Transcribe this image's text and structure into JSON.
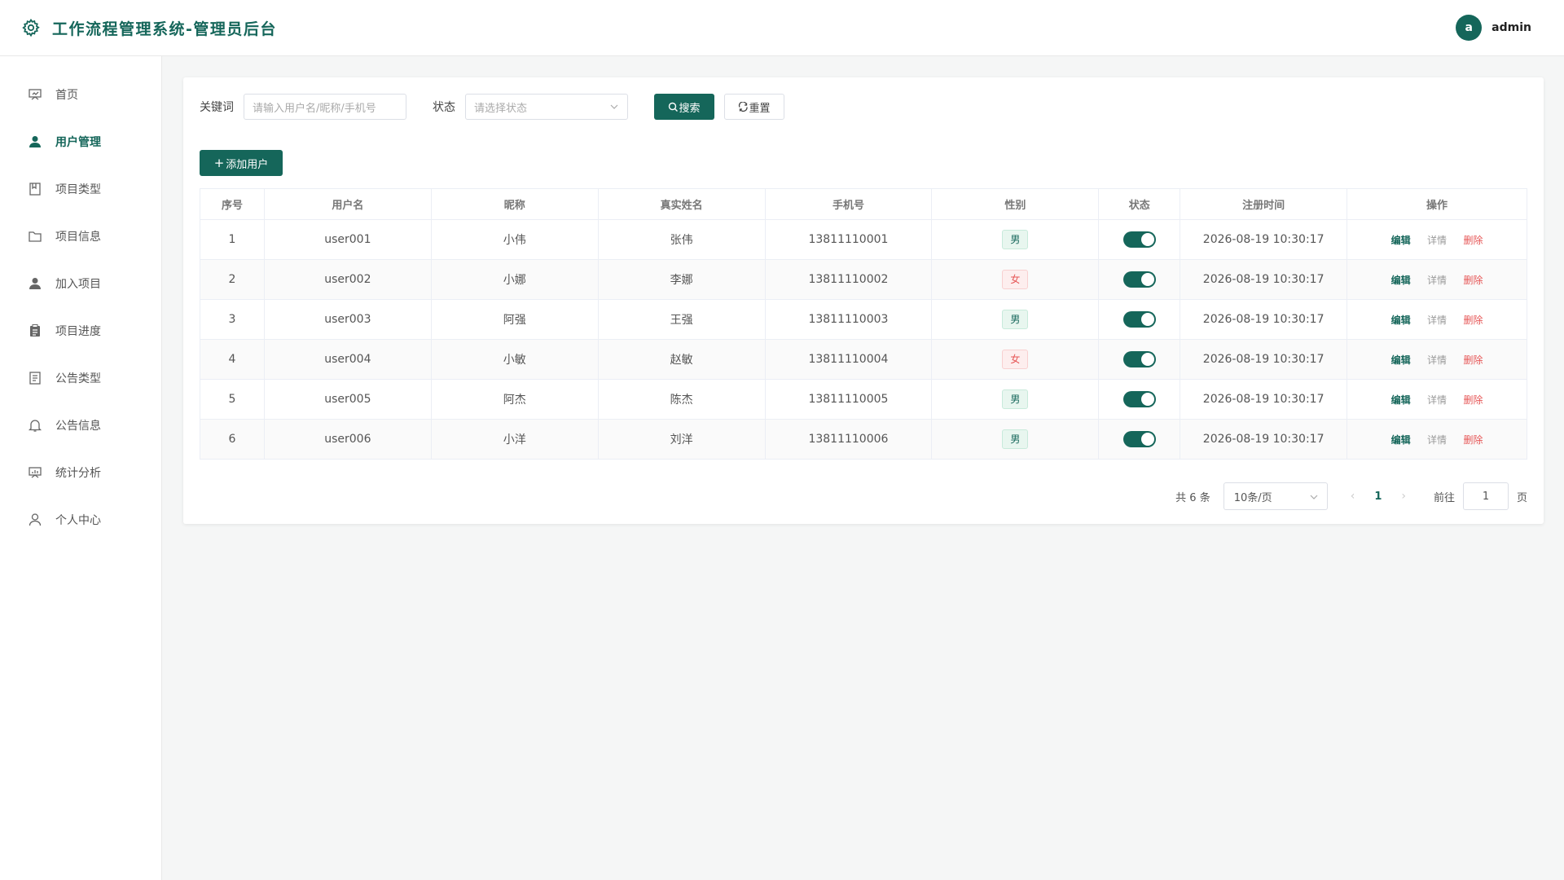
{
  "header": {
    "title": "工作流程管理系统-管理员后台",
    "avatar_letter": "a",
    "username": "admin"
  },
  "sidebar": {
    "items": [
      {
        "label": "首页",
        "icon": "home-board-icon"
      },
      {
        "label": "用户管理",
        "icon": "user-filled-icon",
        "active": true
      },
      {
        "label": "项目类型",
        "icon": "bookmark-icon"
      },
      {
        "label": "项目信息",
        "icon": "folder-icon"
      },
      {
        "label": "加入项目",
        "icon": "user-add-icon"
      },
      {
        "label": "项目进度",
        "icon": "clipboard-icon"
      },
      {
        "label": "公告类型",
        "icon": "document-icon"
      },
      {
        "label": "公告信息",
        "icon": "bell-icon"
      },
      {
        "label": "统计分析",
        "icon": "chart-board-icon"
      },
      {
        "label": "个人中心",
        "icon": "user-outline-icon"
      }
    ]
  },
  "filters": {
    "keyword_label": "关键词",
    "keyword_placeholder": "请输入用户名/昵称/手机号",
    "status_label": "状态",
    "status_placeholder": "请选择状态",
    "search_label": "搜索",
    "reset_label": "重置"
  },
  "add_button_label": "添加用户",
  "table": {
    "headers": [
      "序号",
      "用户名",
      "昵称",
      "真实姓名",
      "手机号",
      "性别",
      "状态",
      "注册时间",
      "操作"
    ],
    "rows": [
      {
        "index": "1",
        "username": "user001",
        "nickname": "小伟",
        "realname": "张伟",
        "phone": "13811110001",
        "gender": "男",
        "enabled": true,
        "registered": "2026-08-19 10:30:17"
      },
      {
        "index": "2",
        "username": "user002",
        "nickname": "小娜",
        "realname": "李娜",
        "phone": "13811110002",
        "gender": "女",
        "enabled": true,
        "registered": "2026-08-19 10:30:17"
      },
      {
        "index": "3",
        "username": "user003",
        "nickname": "阿强",
        "realname": "王强",
        "phone": "13811110003",
        "gender": "男",
        "enabled": true,
        "registered": "2026-08-19 10:30:17"
      },
      {
        "index": "4",
        "username": "user004",
        "nickname": "小敏",
        "realname": "赵敏",
        "phone": "13811110004",
        "gender": "女",
        "enabled": true,
        "registered": "2026-08-19 10:30:17"
      },
      {
        "index": "5",
        "username": "user005",
        "nickname": "阿杰",
        "realname": "陈杰",
        "phone": "13811110005",
        "gender": "男",
        "enabled": true,
        "registered": "2026-08-19 10:30:17"
      },
      {
        "index": "6",
        "username": "user006",
        "nickname": "小洋",
        "realname": "刘洋",
        "phone": "13811110006",
        "gender": "男",
        "enabled": true,
        "registered": "2026-08-19 10:30:17"
      }
    ],
    "ops": {
      "edit": "编辑",
      "detail": "详情",
      "delete": "删除"
    }
  },
  "pagination": {
    "total_text": "共 6 条",
    "page_size": "10条/页",
    "current_page": "1",
    "goto_label": "前往",
    "goto_value": "1",
    "page_suffix": "页"
  },
  "colors": {
    "primary": "#15665a",
    "danger": "#e65555",
    "male_bg": "#e8f6ef",
    "female_bg": "#fdeeee"
  }
}
